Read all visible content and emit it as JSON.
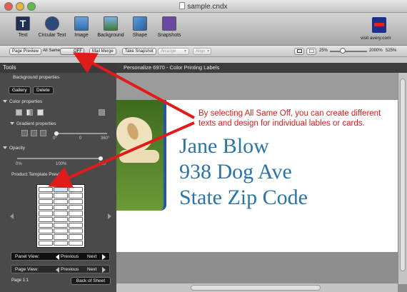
{
  "window": {
    "title": "sample.cndx"
  },
  "toolbar": {
    "items": [
      {
        "label": "Text",
        "icon": "text-icon"
      },
      {
        "label": "Circular Text",
        "icon": "circular-text-icon"
      },
      {
        "label": "Image",
        "icon": "image-icon"
      },
      {
        "label": "Background",
        "icon": "background-icon"
      },
      {
        "label": "Shape",
        "icon": "shape-icon"
      },
      {
        "label": "Snapshots",
        "icon": "snapshots-icon"
      }
    ],
    "avery_link": "visit avery.com"
  },
  "subbar": {
    "page_preview": "Page Preview",
    "all_same": "All Same",
    "toggle_state": "OFF",
    "mail_merge": "Mail Merge",
    "take_snapshot": "Take Snapshot",
    "arrange": "Arrange",
    "align": "Align",
    "zoom_min": "25%",
    "zoom_max": "2000%",
    "zoom_value": "525%"
  },
  "sidebar": {
    "title": "Tools",
    "background_properties": "Background properties",
    "gallery": "Gallery",
    "delete": "Delete",
    "color_properties": "Color properties",
    "gradient_properties": "Gradient properties",
    "gradient_min": "0°",
    "gradient_mid": "0",
    "gradient_max": "360°",
    "opacity": "Opacity",
    "opacity_min": "0%",
    "opacity_mid": "100%",
    "opacity_max": "100",
    "product_template_preview": "Product Template Preview",
    "panel_view": "Panel View:",
    "page_view": "Page View:",
    "previous": "Previous",
    "next": "Next",
    "page_number": "Page 1:1",
    "back_of_sheet": "Back of Sheet"
  },
  "workspace": {
    "title": "Personalize 6970 - Color Printing Labels",
    "address": [
      "Jane Blow",
      "938 Dog Ave",
      "State Zip Code"
    ],
    "annotation": "By selecting All Same Off, you can create different texts and design for individual lables or cards."
  },
  "colors": {
    "accent": "#e01b1b",
    "address_text": "#2b74a8",
    "sidebar": "#4a4a4a"
  }
}
